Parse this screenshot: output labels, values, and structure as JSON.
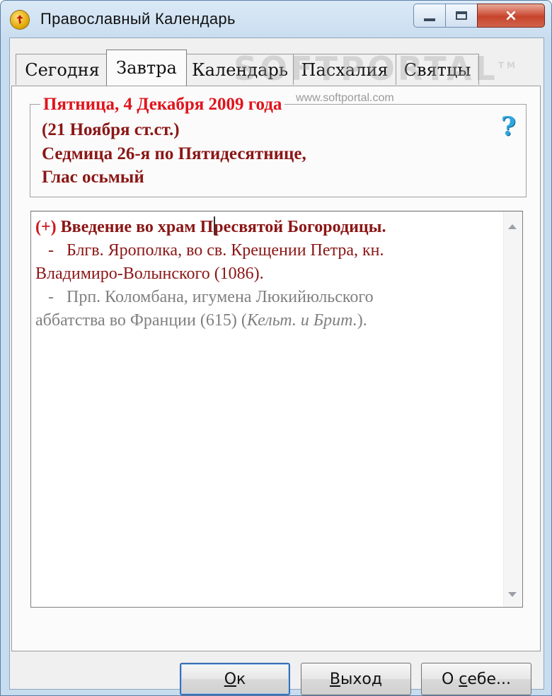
{
  "window": {
    "title": "Православный Календарь",
    "icon": "orthodox-cross-icon",
    "controls": {
      "minimize": "minimize-icon",
      "maximize": "maximize-icon",
      "close": "×"
    }
  },
  "tabs": [
    {
      "label": "Сегодня",
      "active": false
    },
    {
      "label": "Завтра",
      "active": true
    },
    {
      "label": "Календарь",
      "active": false
    },
    {
      "label": "Пасхалия",
      "active": false
    },
    {
      "label": "Святцы",
      "active": false
    }
  ],
  "day_info": {
    "date": "Пятница, 4 Декабря 2009 года",
    "old_style": "(21 Ноября ст.ст.)",
    "week": "Седмица 26-я по Пятидесятнице,",
    "tone": "Глас осьмый",
    "help": "?"
  },
  "saints": {
    "feast_mark": "(+)",
    "feast_name_a": "Введение во храм П",
    "feast_name_b": "ресвятой Богородицы",
    "feast_end": ".",
    "entry1_line1": "   -   Блгв. Ярополка, во св. Крещении Петра, кн.",
    "entry1_line2": "Владимиро-Волынского (1086).",
    "entry2_line1": "   -   Прп. Коломбана, игумена Люкийюльского",
    "entry2_line2_a": "аббатства во Франции (615) (",
    "entry2_line2_italic": "Кельт. и Брит.",
    "entry2_line2_b": ")."
  },
  "buttons": {
    "ok_u": "О",
    "ok_rest": "к",
    "exit_u": "В",
    "exit_rest": "ыход",
    "about_a": "О ",
    "about_u": "с",
    "about_rest": "ебе..."
  },
  "watermark": {
    "brand": "SOFTPORTAL",
    "tm": "TM",
    "url": "www.softportal.com"
  },
  "colors": {
    "date_red": "#e0141c",
    "dark_red": "#8b1616",
    "gray_text": "#808080",
    "help_blue": "#2fa6e0"
  }
}
